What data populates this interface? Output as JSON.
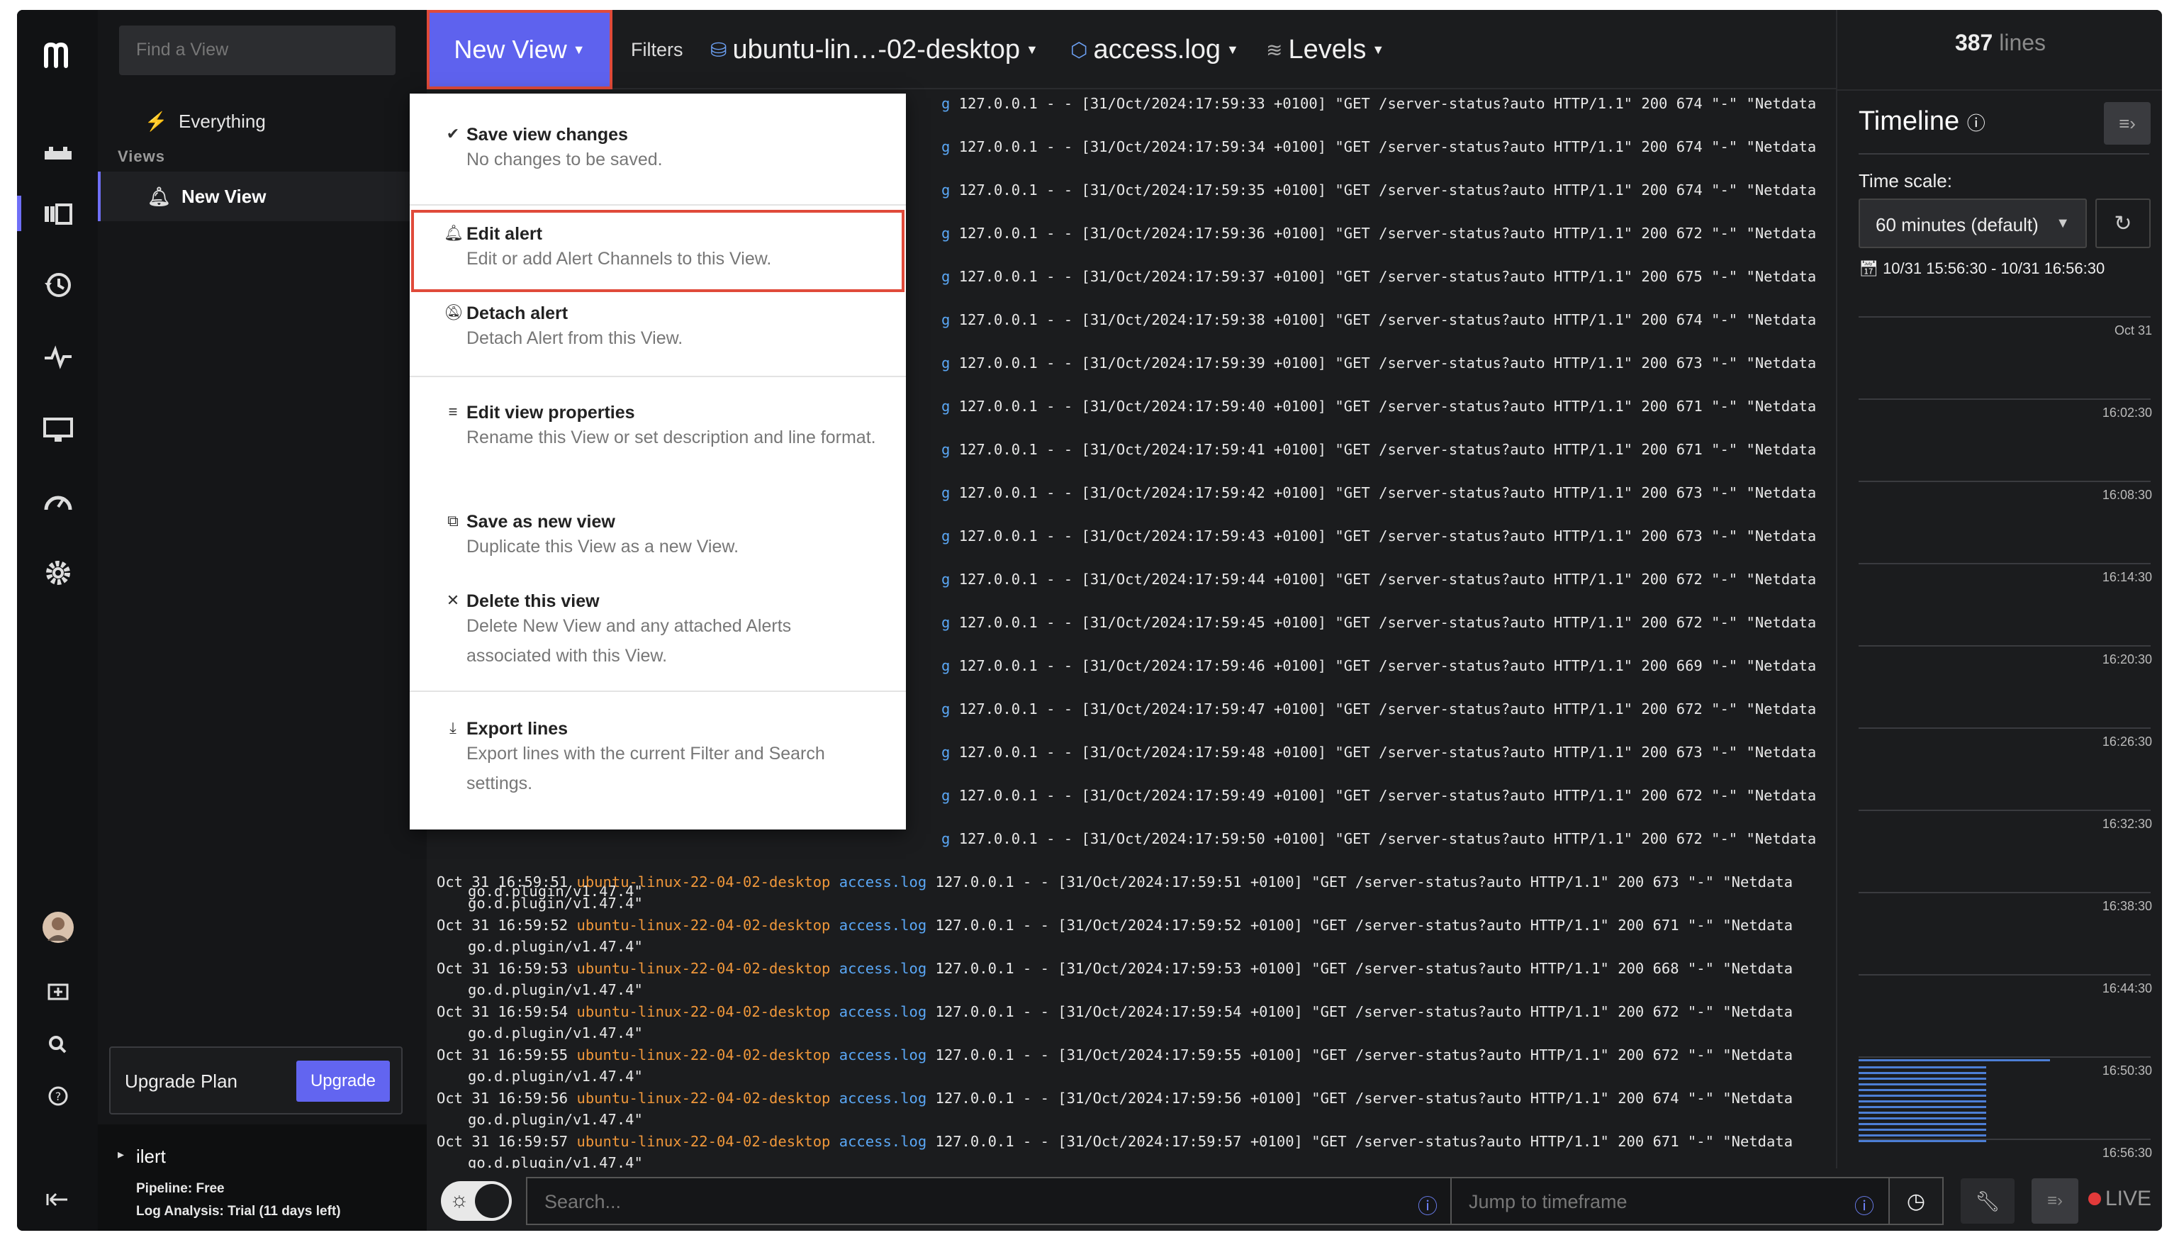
{
  "sidebar": {
    "find_placeholder": "Find a View",
    "everything_label": "Everything",
    "views_heading": "Views",
    "active_view": "New View",
    "upgrade_label": "Upgrade Plan",
    "upgrade_button": "Upgrade",
    "org_name": "ilert",
    "pipeline": "Pipeline: Free",
    "log_analysis": "Log Analysis: Trial (11 days left)"
  },
  "topbar": {
    "view_title": "New View",
    "filters_label": "Filters",
    "source": "ubuntu-lin…-02-desktop",
    "app": "access.log",
    "levels": "Levels"
  },
  "menu": {
    "items": [
      {
        "title": "Save view changes",
        "desc": "No changes to be saved.",
        "icon": "✔"
      },
      {
        "title": "Edit alert",
        "desc": "Edit or add Alert Channels to this View.",
        "icon": "bell"
      },
      {
        "title": "Detach alert",
        "desc": "Detach Alert from this View.",
        "icon": "bell-off"
      },
      {
        "title": "Edit view properties",
        "desc": "Rename this View or set description and line format.",
        "icon": "≡"
      },
      {
        "title": "Save as new view",
        "desc": "Duplicate this View as a new View.",
        "icon": "copy"
      },
      {
        "title": "Delete this view",
        "desc": "Delete New View and any attached Alerts associated with this View.",
        "icon": "✕"
      },
      {
        "title": "Export lines",
        "desc": "Export lines with the current Filter and Search settings.",
        "icon": "⤓"
      }
    ]
  },
  "logs": {
    "hidden_rows": [
      {
        "msg": "127.0.0.1 - - [31/Oct/2024:17:59:33 +0100] \"GET /server-status?auto HTTP/1.1\" 200 674 \"-\" \"Netdata"
      },
      {
        "msg": "127.0.0.1 - - [31/Oct/2024:17:59:34 +0100] \"GET /server-status?auto HTTP/1.1\" 200 674 \"-\" \"Netdata"
      },
      {
        "msg": "127.0.0.1 - - [31/Oct/2024:17:59:35 +0100] \"GET /server-status?auto HTTP/1.1\" 200 674 \"-\" \"Netdata"
      },
      {
        "msg": "127.0.0.1 - - [31/Oct/2024:17:59:36 +0100] \"GET /server-status?auto HTTP/1.1\" 200 672 \"-\" \"Netdata"
      },
      {
        "msg": "127.0.0.1 - - [31/Oct/2024:17:59:37 +0100] \"GET /server-status?auto HTTP/1.1\" 200 675 \"-\" \"Netdata"
      },
      {
        "msg": "127.0.0.1 - - [31/Oct/2024:17:59:38 +0100] \"GET /server-status?auto HTTP/1.1\" 200 674 \"-\" \"Netdata"
      },
      {
        "msg": "127.0.0.1 - - [31/Oct/2024:17:59:39 +0100] \"GET /server-status?auto HTTP/1.1\" 200 673 \"-\" \"Netdata"
      },
      {
        "msg": "127.0.0.1 - - [31/Oct/2024:17:59:40 +0100] \"GET /server-status?auto HTTP/1.1\" 200 671 \"-\" \"Netdata"
      },
      {
        "msg": "127.0.0.1 - - [31/Oct/2024:17:59:41 +0100] \"GET /server-status?auto HTTP/1.1\" 200 671 \"-\" \"Netdata"
      },
      {
        "msg": "127.0.0.1 - - [31/Oct/2024:17:59:42 +0100] \"GET /server-status?auto HTTP/1.1\" 200 673 \"-\" \"Netdata"
      },
      {
        "msg": "127.0.0.1 - - [31/Oct/2024:17:59:43 +0100] \"GET /server-status?auto HTTP/1.1\" 200 673 \"-\" \"Netdata"
      },
      {
        "msg": "127.0.0.1 - - [31/Oct/2024:17:59:44 +0100] \"GET /server-status?auto HTTP/1.1\" 200 672 \"-\" \"Netdata"
      },
      {
        "msg": "127.0.0.1 - - [31/Oct/2024:17:59:45 +0100] \"GET /server-status?auto HTTP/1.1\" 200 672 \"-\" \"Netdata"
      },
      {
        "msg": "127.0.0.1 - - [31/Oct/2024:17:59:46 +0100] \"GET /server-status?auto HTTP/1.1\" 200 669 \"-\" \"Netdata"
      },
      {
        "msg": "127.0.0.1 - - [31/Oct/2024:17:59:47 +0100] \"GET /server-status?auto HTTP/1.1\" 200 672 \"-\" \"Netdata"
      },
      {
        "msg": "127.0.0.1 - - [31/Oct/2024:17:59:48 +0100] \"GET /server-status?auto HTTP/1.1\" 200 673 \"-\" \"Netdata"
      },
      {
        "msg": "127.0.0.1 - - [31/Oct/2024:17:59:49 +0100] \"GET /server-status?auto HTTP/1.1\" 200 672 \"-\" \"Netdata"
      },
      {
        "msg": "127.0.0.1 - - [31/Oct/2024:17:59:50 +0100] \"GET /server-status?auto HTTP/1.1\" 200 672 \"-\" \"Netdata"
      }
    ],
    "hidden_prefix": "g",
    "partial_row_cont": "go.d.plugin/v1.47.4\"",
    "rows": [
      {
        "time": "Oct 31 16:59:51",
        "host": "ubuntu-linux-22-04-02-desktop",
        "file": "access.log",
        "msg": "127.0.0.1 - - [31/Oct/2024:17:59:51 +0100] \"GET /server-status?auto HTTP/1.1\" 200 673 \"-\" \"Netdata",
        "cont": "go.d.plugin/v1.47.4\""
      },
      {
        "time": "Oct 31 16:59:52",
        "host": "ubuntu-linux-22-04-02-desktop",
        "file": "access.log",
        "msg": "127.0.0.1 - - [31/Oct/2024:17:59:52 +0100] \"GET /server-status?auto HTTP/1.1\" 200 671 \"-\" \"Netdata",
        "cont": "go.d.plugin/v1.47.4\""
      },
      {
        "time": "Oct 31 16:59:53",
        "host": "ubuntu-linux-22-04-02-desktop",
        "file": "access.log",
        "msg": "127.0.0.1 - - [31/Oct/2024:17:59:53 +0100] \"GET /server-status?auto HTTP/1.1\" 200 668 \"-\" \"Netdata",
        "cont": "go.d.plugin/v1.47.4\""
      },
      {
        "time": "Oct 31 16:59:54",
        "host": "ubuntu-linux-22-04-02-desktop",
        "file": "access.log",
        "msg": "127.0.0.1 - - [31/Oct/2024:17:59:54 +0100] \"GET /server-status?auto HTTP/1.1\" 200 672 \"-\" \"Netdata",
        "cont": "go.d.plugin/v1.47.4\""
      },
      {
        "time": "Oct 31 16:59:55",
        "host": "ubuntu-linux-22-04-02-desktop",
        "file": "access.log",
        "msg": "127.0.0.1 - - [31/Oct/2024:17:59:55 +0100] \"GET /server-status?auto HTTP/1.1\" 200 672 \"-\" \"Netdata",
        "cont": "go.d.plugin/v1.47.4\""
      },
      {
        "time": "Oct 31 16:59:56",
        "host": "ubuntu-linux-22-04-02-desktop",
        "file": "access.log",
        "msg": "127.0.0.1 - - [31/Oct/2024:17:59:56 +0100] \"GET /server-status?auto HTTP/1.1\" 200 674 \"-\" \"Netdata",
        "cont": "go.d.plugin/v1.47.4\""
      },
      {
        "time": "Oct 31 16:59:57",
        "host": "ubuntu-linux-22-04-02-desktop",
        "file": "access.log",
        "msg": "127.0.0.1 - - [31/Oct/2024:17:59:57 +0100] \"GET /server-status?auto HTTP/1.1\" 200 671 \"-\" \"Netdata",
        "cont": "go.d.plugin/v1.47.4\""
      }
    ]
  },
  "timeline": {
    "line_count": "387",
    "line_count_unit": "lines",
    "title": "Timeline",
    "time_scale_label": "Time scale:",
    "time_scale_value": "60 minutes (default)",
    "range": "10/31 15:56:30 - 10/31 16:56:30",
    "ticks": [
      "Oct 31",
      "16:02:30",
      "16:08:30",
      "16:14:30",
      "16:20:30",
      "16:26:30",
      "16:32:30",
      "16:38:30",
      "16:44:30",
      "16:50:30",
      "16:56:30"
    ]
  },
  "bottombar": {
    "search_placeholder": "Search...",
    "jump_placeholder": "Jump to timeframe",
    "live_label": "LIVE"
  },
  "colors": {
    "accent": "#5e62ee",
    "highlight_border": "#e04a3a",
    "log_host": "#f0973a",
    "log_file": "#5aa7f5"
  }
}
